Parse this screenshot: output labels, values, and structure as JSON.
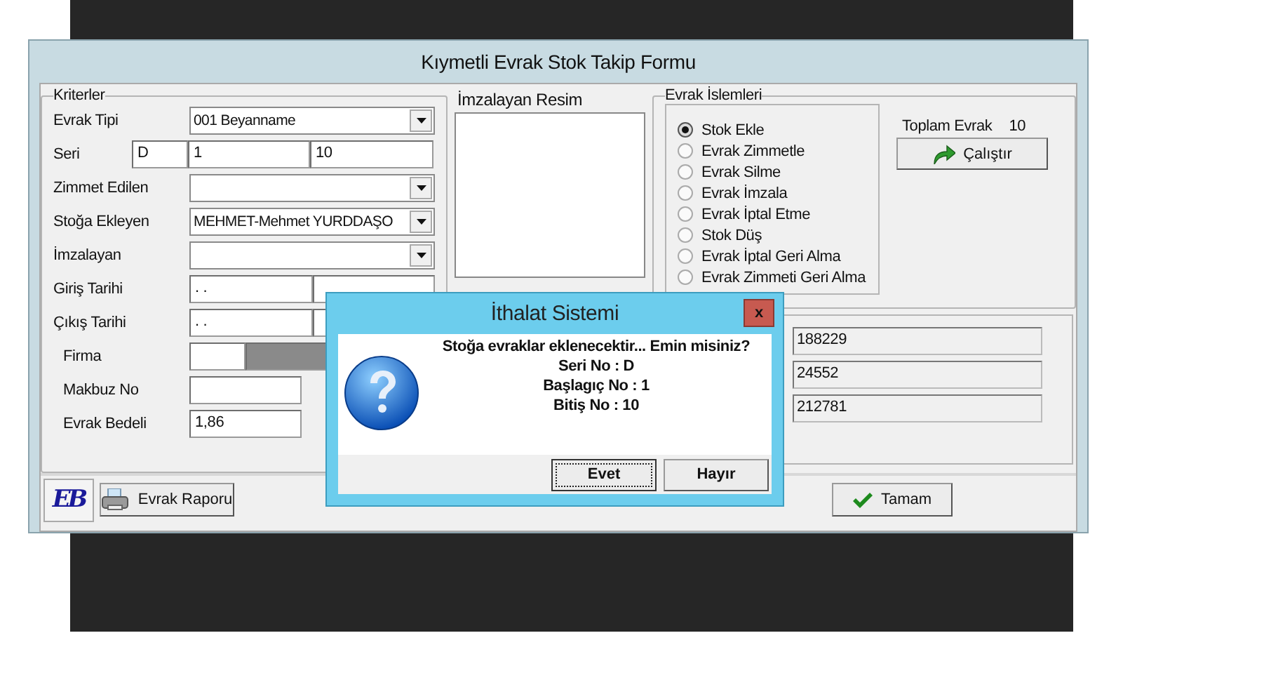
{
  "form": {
    "title": "Kıymetli Evrak Stok Takip Formu",
    "criteria": {
      "title": "Kriterler",
      "rows": [
        {
          "kind": "combo",
          "label": "Evrak Tipi",
          "value": "001 Beyanname"
        },
        {
          "kind": "serial",
          "label": "Seri",
          "values": [
            "D",
            "1",
            "10"
          ]
        },
        {
          "kind": "combo",
          "label": "Zimmet Edilen"
        },
        {
          "kind": "combo",
          "label": "Stoğa Ekleyen",
          "value": "MEHMET-Mehmet YURDDAŞO"
        },
        {
          "kind": "combo",
          "label": "İmzalayan"
        },
        {
          "kind": "date",
          "label": "Giriş Tarihi",
          "value": ". ."
        },
        {
          "kind": "date",
          "label": "Çıkış Tarihi",
          "value": ". ."
        },
        {
          "kind": "lookup",
          "label": "Firma"
        },
        {
          "kind": "text",
          "label": "Makbuz No"
        },
        {
          "kind": "text",
          "label": "Evrak Bedeli",
          "value": "1,86"
        }
      ]
    },
    "signature_image": {
      "title": "İmzalayan Resim"
    },
    "operations": {
      "title": "Evrak İslemleri",
      "options": [
        {
          "label": "Stok Ekle",
          "selected": true
        },
        {
          "label": "Evrak Zimmetle",
          "selected": false
        },
        {
          "label": "Evrak Silme",
          "selected": false
        },
        {
          "label": "Evrak İmzala",
          "selected": false
        },
        {
          "label": "Evrak İptal Etme",
          "selected": false
        },
        {
          "label": "Stok Düş",
          "selected": false
        },
        {
          "label": "Evrak İptal Geri Alma",
          "selected": false
        },
        {
          "label": "Evrak Zimmeti Geri Alma",
          "selected": false
        }
      ],
      "total_label": "Toplam Evrak",
      "total": "10",
      "run_button": "Çalıştır"
    },
    "readonly_fields": [
      "188229",
      "24552",
      "212781"
    ],
    "logo": "EB",
    "report_button": "Evrak Raporu",
    "ok_button": "Tamam"
  },
  "dialog": {
    "title": "İthalat Sistemi",
    "close": "x",
    "lines": [
      "Stoğa evraklar eklenecektir... Emin misiniz?",
      "Seri No : D",
      "Başlagıç No : 1",
      "Bitiş No : 10"
    ],
    "buttons": [
      {
        "label": "Evet",
        "selected": true
      },
      {
        "label": "Hayır",
        "selected": false
      }
    ]
  }
}
